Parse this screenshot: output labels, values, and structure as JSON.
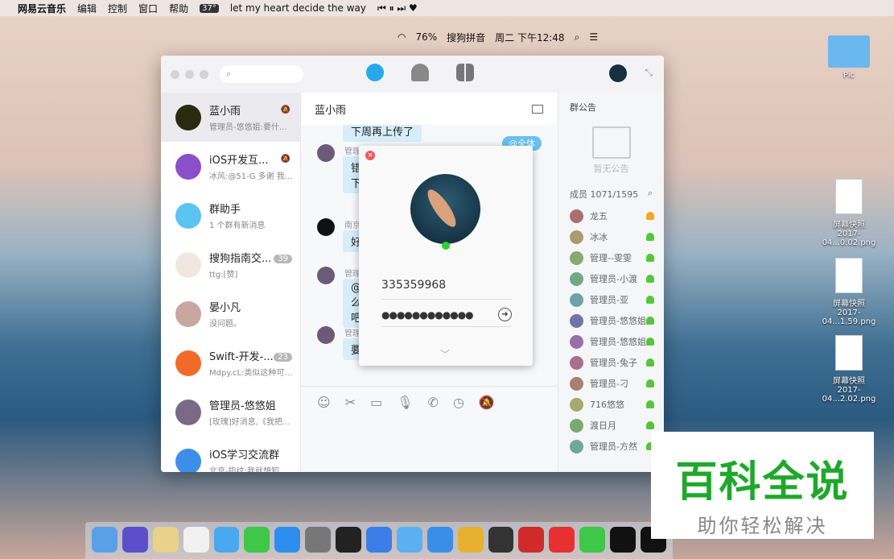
{
  "menubar": {
    "app": "网易云音乐",
    "menus": [
      "编辑",
      "控制",
      "窗口",
      "帮助"
    ],
    "temp": "37°",
    "song": "let my heart decide the way",
    "battery": "76%",
    "ime": "搜狗拼音",
    "clock": "周二 下午12:48"
  },
  "window": {
    "search_placeholder": "",
    "conversations": [
      {
        "name": "蓝小雨",
        "preview": "管理员-悠悠姐:要什...",
        "badge": "",
        "muted": true,
        "color": "#2a2a10"
      },
      {
        "name": "iOS开发互...",
        "preview": "冰风:@51-G 多谢 我...",
        "badge": "",
        "muted": true,
        "color": "#8a4fc9"
      },
      {
        "name": "群助手",
        "preview": "1 个群有新消息",
        "badge": "",
        "muted": false,
        "color": "#5cc4f0"
      },
      {
        "name": "搜狗指南交...",
        "preview": "ttg:[赞]",
        "badge": "39",
        "muted": false,
        "color": "#f0e8e0"
      },
      {
        "name": "晏小凡",
        "preview": "没问题。",
        "badge": "",
        "muted": false,
        "color": "#c9a7a0"
      },
      {
        "name": "Swift-开发-...",
        "preview": "Mdpy.cL:类似这种可...",
        "badge": "23",
        "muted": false,
        "color": "#f26a2a"
      },
      {
        "name": "管理员-悠悠姐",
        "preview": "[玫瑰]好消息,《我把...",
        "badge": "",
        "muted": false,
        "color": "#7a6a88"
      },
      {
        "name": "iOS学习交流群",
        "preview": "北京-指纹:我就想知...",
        "badge": "",
        "muted": false,
        "color": "#3d8ee8"
      }
    ],
    "chat": {
      "title": "蓝小雨",
      "messages": [
        {
          "sender": "",
          "text": "下周再上传了"
        },
        {
          "sender": "管理",
          "text": "错\n下"
        },
        {
          "sender": "南京",
          "text": "好"
        },
        {
          "sender": "管理",
          "text": "@\n么\n吧"
        },
        {
          "sender": "管理",
          "text": "要"
        }
      ],
      "at_all": "@全体"
    },
    "panel": {
      "title": "群公告",
      "no_notice": "暂无公告",
      "members_label": "成员 1071/1595",
      "members": [
        "龙五",
        "冰冰",
        "管理--雯雯",
        "管理员-小渡",
        "管理员-亚",
        "管理员-悠悠姐",
        "管理员-悠悠姐",
        "管理员-兔子",
        "管理员-刁",
        "716悠悠",
        "渡日月",
        "管理员-方然"
      ]
    }
  },
  "login": {
    "account": "335359968",
    "password": "●●●●●●●●●●●●",
    "status_color": "#2dd12d"
  },
  "desktop": {
    "folder": "Pic",
    "files": [
      {
        "name": "屏幕快照",
        "sub": "2017-04...0.02.png"
      },
      {
        "name": "屏幕快照",
        "sub": "2017-04...1.59.png"
      },
      {
        "name": "屏幕快照",
        "sub": "2017-04...2.02.png"
      }
    ],
    "file_type": "PNG"
  },
  "watermark": {
    "title": "百科全说",
    "subtitle": "助你轻松解决"
  }
}
